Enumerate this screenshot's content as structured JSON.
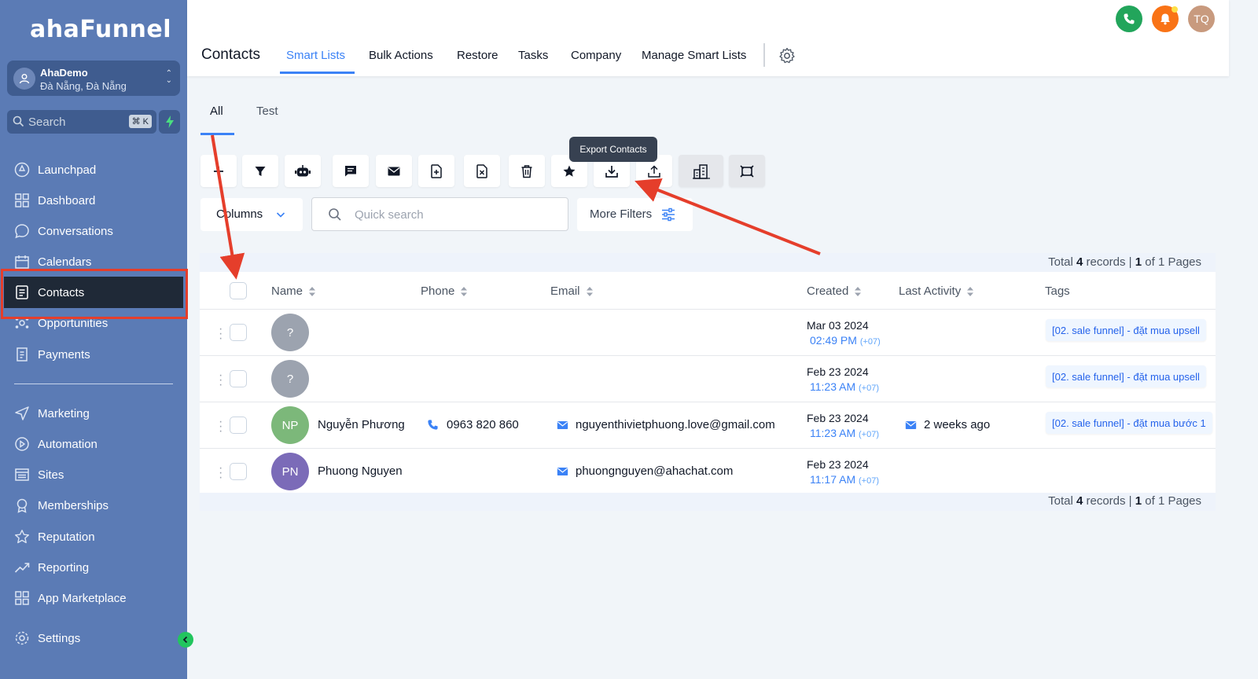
{
  "sidebar": {
    "logo": "ahaFunnel",
    "account": {
      "name": "AhaDemo",
      "location": "Đà Nẵng, Đà Nẵng"
    },
    "search": {
      "placeholder": "Search",
      "shortcut": "⌘ K"
    },
    "items": [
      {
        "label": "Launchpad",
        "icon": "rocket-icon"
      },
      {
        "label": "Dashboard",
        "icon": "grid-icon"
      },
      {
        "label": "Conversations",
        "icon": "chat-icon"
      },
      {
        "label": "Calendars",
        "icon": "calendar-icon"
      },
      {
        "label": "Contacts",
        "icon": "contacts-icon"
      },
      {
        "label": "Opportunities",
        "icon": "opportunities-icon"
      },
      {
        "label": "Payments",
        "icon": "payments-icon"
      },
      {
        "label": "Marketing",
        "icon": "send-icon"
      },
      {
        "label": "Automation",
        "icon": "automation-icon"
      },
      {
        "label": "Sites",
        "icon": "sites-icon"
      },
      {
        "label": "Memberships",
        "icon": "badge-icon"
      },
      {
        "label": "Reputation",
        "icon": "star-icon"
      },
      {
        "label": "Reporting",
        "icon": "trend-icon"
      },
      {
        "label": "App Marketplace",
        "icon": "apps-icon"
      },
      {
        "label": "Settings",
        "icon": "gear-icon"
      }
    ]
  },
  "header": {
    "title": "Contacts",
    "tabs": [
      "Smart Lists",
      "Bulk Actions",
      "Restore",
      "Tasks",
      "Company",
      "Manage Smart Lists"
    ],
    "user_initials": "TQ",
    "colors": {
      "phone": "#22a55b",
      "bell": "#f97316",
      "avatar": "#c89a7e"
    }
  },
  "subtabs": [
    "All",
    "Test"
  ],
  "toolbar": {
    "tooltip": "Export Contacts",
    "buttons": [
      "add",
      "filter",
      "robot",
      "sms",
      "email",
      "add-tag",
      "remove-tag",
      "delete",
      "star",
      "export",
      "import",
      "company",
      "merge"
    ]
  },
  "filters": {
    "columns_label": "Columns",
    "search_placeholder": "Quick search",
    "more_filters_label": "More Filters"
  },
  "table": {
    "total_prefix": "Total",
    "total_count": "4",
    "total_mid": "records |",
    "page_current": "1",
    "page_suffix": "of 1 Pages",
    "columns": [
      "Name",
      "Phone",
      "Email",
      "Created",
      "Last Activity",
      "Tags"
    ],
    "rows": [
      {
        "initials": "?",
        "avatar_color": "#9ca3af",
        "name": "",
        "phone": "",
        "email": "",
        "created_date": "Mar 03 2024",
        "created_time": "02:49 PM",
        "tz": "(+07)",
        "last_activity": "",
        "tag": "[02. sale funnel] - đặt mua upsell"
      },
      {
        "initials": "?",
        "avatar_color": "#9ca3af",
        "name": "",
        "phone": "",
        "email": "",
        "created_date": "Feb 23 2024",
        "created_time": "11:23 AM",
        "tz": "(+07)",
        "last_activity": "",
        "tag": "[02. sale funnel] - đặt mua upsell"
      },
      {
        "initials": "NP",
        "avatar_color": "#7cb87a",
        "name": "Nguyễn Phương",
        "phone": "0963 820 860",
        "email": "nguyenthivietphuong.love@gmail.com",
        "created_date": "Feb 23 2024",
        "created_time": "11:23 AM",
        "tz": "(+07)",
        "last_activity": "2 weeks ago",
        "tag": "[02. sale funnel] - đặt mua bước 1"
      },
      {
        "initials": "PN",
        "avatar_color": "#7b6bb8",
        "name": "Phuong Nguyen",
        "phone": "",
        "email": "phuongnguyen@ahachat.com",
        "created_date": "Feb 23 2024",
        "created_time": "11:17 AM",
        "tz": "(+07)",
        "last_activity": "",
        "tag": ""
      }
    ]
  },
  "annotation_color": "#e53e2b"
}
